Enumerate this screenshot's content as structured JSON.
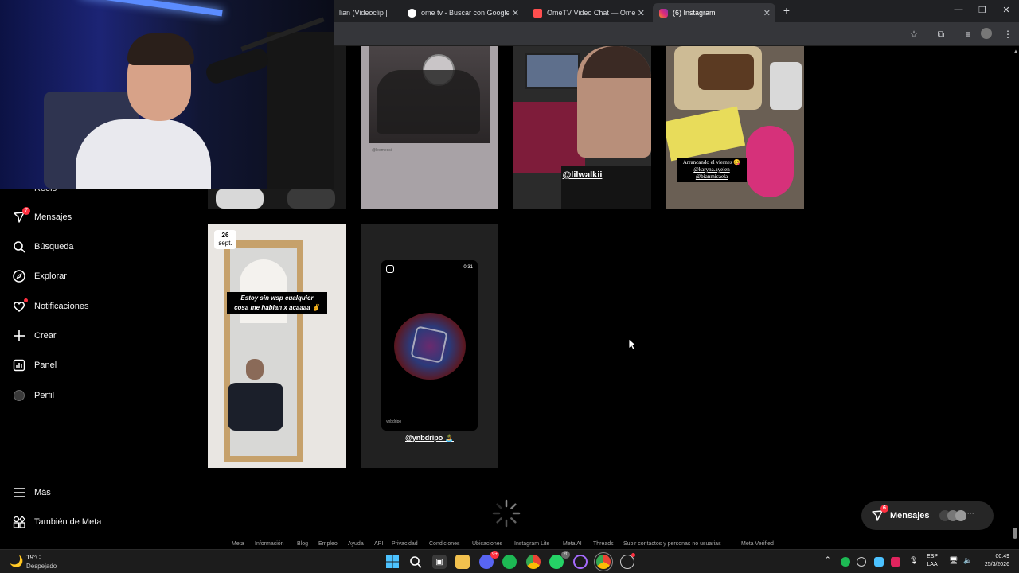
{
  "browser": {
    "tabs": [
      {
        "title": "lian (Videoclip |",
        "favicon_color": "#ff0000",
        "close": "✕"
      },
      {
        "title": "ome tv - Buscar con Google",
        "favicon_color": "#ffffff",
        "close": "✕"
      },
      {
        "title": "OmeTV Video Chat — Ome",
        "favicon_color": "#ff4f4f",
        "close": "✕"
      },
      {
        "title": "(6) Instagram",
        "favicon_color": "#e1306c",
        "close": "✕"
      }
    ],
    "new_tab": "+",
    "window_controls": {
      "minimize": "—",
      "restore": "❐",
      "close": "✕"
    }
  },
  "sidebar": {
    "items": [
      {
        "label": "Reels",
        "icon": "reels-icon"
      },
      {
        "label": "Mensajes",
        "icon": "messenger-icon",
        "badge": "7"
      },
      {
        "label": "Búsqueda",
        "icon": "search-icon"
      },
      {
        "label": "Explorar",
        "icon": "compass-icon"
      },
      {
        "label": "Notificaciones",
        "icon": "heart-icon"
      },
      {
        "label": "Crear",
        "icon": "plus-icon"
      },
      {
        "label": "Panel",
        "icon": "chart-icon"
      },
      {
        "label": "Perfil",
        "icon": "avatar"
      },
      {
        "label": "Más",
        "icon": "menu-icon"
      },
      {
        "label": "También de Meta",
        "icon": "meta-grid-icon"
      }
    ]
  },
  "posts": {
    "row1": [
      {
        "type": "partial"
      },
      {
        "type": "story",
        "handle": "@leomessi"
      },
      {
        "type": "story",
        "mention": "@lilwalkii"
      },
      {
        "type": "story",
        "caption_lines": [
          "Arrancando el viernes 😋",
          "@karyna.ayelen",
          "@bianmicaela"
        ]
      }
    ],
    "row2": [
      {
        "type": "story",
        "date_day": "26",
        "date_month": "sept.",
        "caption_lines": [
          "Estoy sin wsp cualquier",
          "cosa me  hablan x acaaaa ✌️"
        ]
      },
      {
        "type": "reel",
        "duration": "0:31",
        "watermark": "ynbdripo",
        "mention": "@ynbdripo 🏝️"
      }
    ]
  },
  "footer_links": [
    "Meta",
    "Información",
    "Blog",
    "Empleo",
    "Ayuda",
    "API",
    "Privacidad",
    "Condiciones",
    "Ubicaciones",
    "Instagram Lite",
    "Meta AI",
    "Threads",
    "Subir contactos y personas no usuarias",
    "Meta Verified"
  ],
  "messages_pill": {
    "label": "Mensajes",
    "badge": "6",
    "more": "···"
  },
  "taskbar": {
    "weather_temp": "19°C",
    "weather_desc": "Despejado",
    "lang": "ESP",
    "lang_sub": "LAA",
    "time": "00:49",
    "date": "25/3/2026",
    "discord_badge": "9+",
    "whatsapp_badge": "20"
  },
  "colors": {
    "accent_red": "#ff3040",
    "bg": "#000000"
  }
}
